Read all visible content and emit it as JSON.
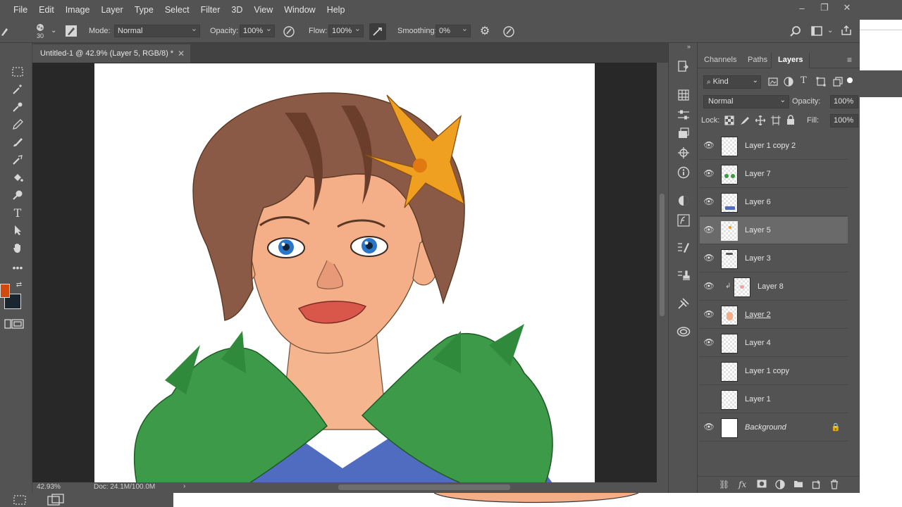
{
  "menu": [
    "File",
    "Edit",
    "Image",
    "Layer",
    "Type",
    "Select",
    "Filter",
    "3D",
    "View",
    "Window",
    "Help"
  ],
  "window_controls": [
    "–",
    "❐",
    "✕"
  ],
  "options": {
    "brush_size": "30",
    "mode_label": "Mode:",
    "mode_value": "Normal",
    "opacity_label": "Opacity:",
    "opacity_value": "100%",
    "flow_label": "Flow:",
    "flow_value": "100%",
    "smoothing_label": "Smoothing:",
    "smoothing_value": "0%"
  },
  "document": {
    "tab_title": "Untitled-1 @ 42.9% (Layer 5, RGB/8) *",
    "zoom": "42.93%",
    "doc_size": "Doc: 24.1M/100.0M"
  },
  "colors": {
    "foreground": "#d24a0f",
    "background": "#1b2530",
    "ui_bg": "#535353",
    "selected_layer": "#6a6a6a"
  },
  "panel": {
    "tabs": [
      "Channels",
      "Paths",
      "Layers"
    ],
    "active_tab": "Layers",
    "filter_kind": "Kind",
    "blend_mode": "Normal",
    "opacity_label": "Opacity:",
    "opacity_value": "100%",
    "lock_label": "Lock:",
    "fill_label": "Fill:",
    "fill_value": "100%"
  },
  "layers": [
    {
      "name": "Layer 1 copy 2",
      "visible": true
    },
    {
      "name": "Layer 7",
      "visible": true
    },
    {
      "name": "Layer 6",
      "visible": true
    },
    {
      "name": "Layer 5",
      "visible": true,
      "selected": true
    },
    {
      "name": "Layer 3",
      "visible": true
    },
    {
      "name": "Layer 8",
      "visible": true,
      "clipped": true
    },
    {
      "name": "Layer 2",
      "visible": true
    },
    {
      "name": "Layer 4",
      "visible": true
    },
    {
      "name": "Layer 1 copy",
      "visible": false
    },
    {
      "name": "Layer 1",
      "visible": false
    },
    {
      "name": "Background",
      "visible": true,
      "locked": true
    }
  ],
  "footer_icons": [
    "link-icon",
    "fx-icon",
    "mask-icon",
    "adjustment-icon",
    "folder-icon",
    "new-layer-icon",
    "trash-icon"
  ],
  "footer_fx": "fx",
  "tool_text_glyph": "T"
}
